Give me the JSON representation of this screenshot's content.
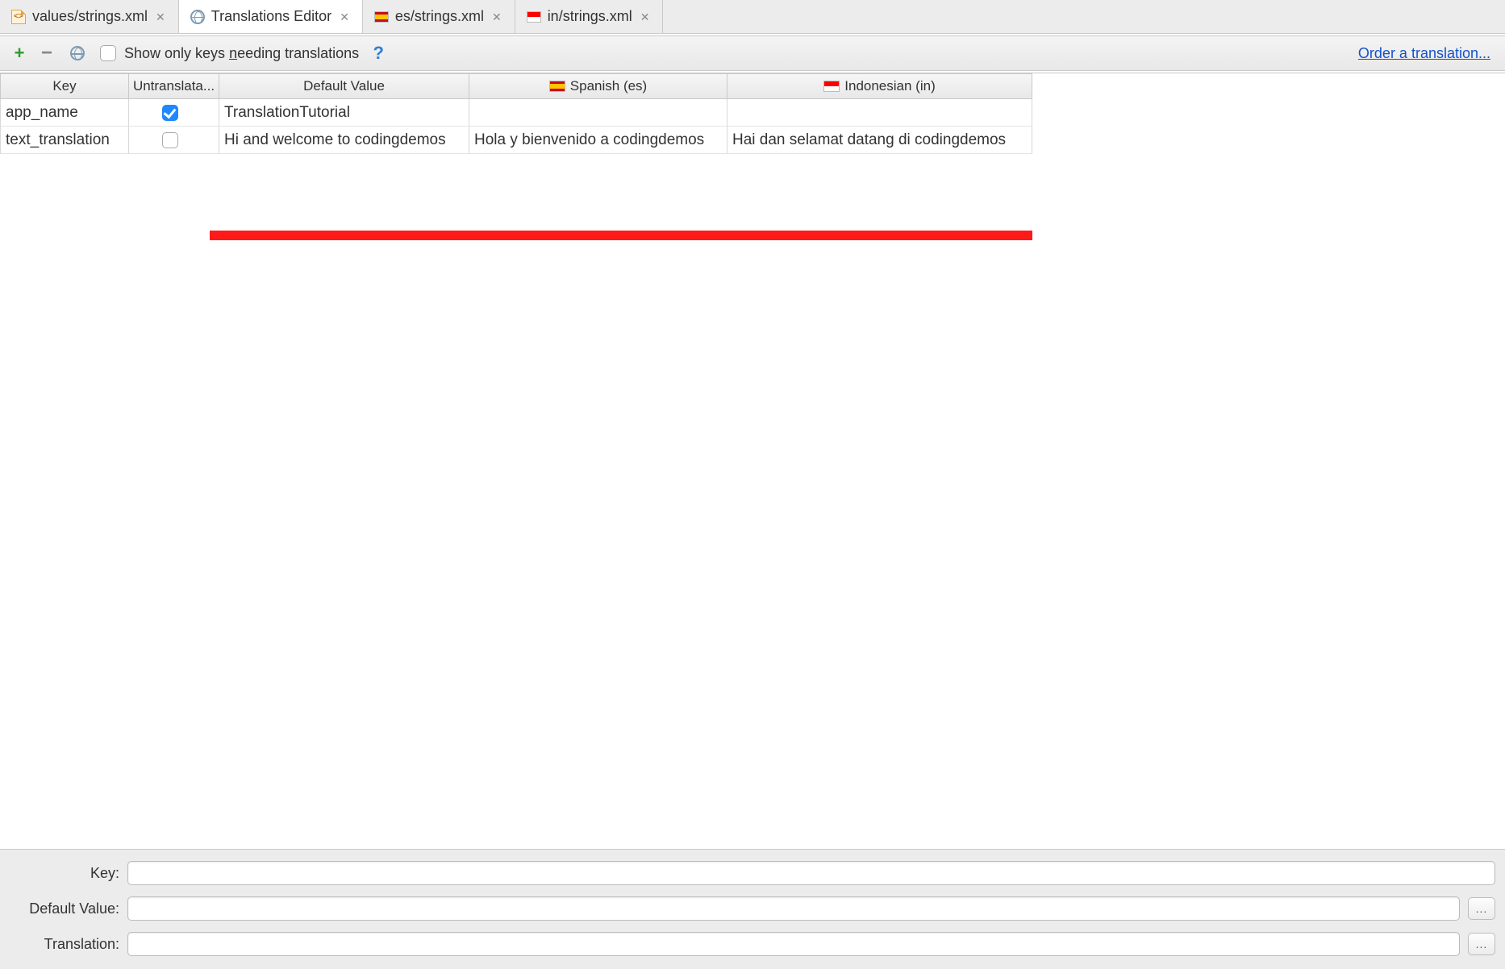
{
  "tabs": [
    {
      "label": "values/strings.xml",
      "icon": "xml",
      "active": false
    },
    {
      "label": "Translations Editor",
      "icon": "globe",
      "active": true
    },
    {
      "label": "es/strings.xml",
      "icon": "flag-es",
      "active": false
    },
    {
      "label": "in/strings.xml",
      "icon": "flag-in",
      "active": false
    }
  ],
  "toolbar": {
    "show_only_label_pre": "Show only keys ",
    "show_only_label_u": "n",
    "show_only_label_post": "eeding translations",
    "order_link": "Order a translation..."
  },
  "columns": {
    "key": "Key",
    "untranslatable": "Untranslata...",
    "default": "Default Value",
    "es": "Spanish (es)",
    "in": "Indonesian (in)"
  },
  "rows": [
    {
      "key": "app_name",
      "untranslatable": true,
      "default": "TranslationTutorial",
      "es": "",
      "in": ""
    },
    {
      "key": "text_translation",
      "untranslatable": false,
      "default": "Hi and welcome to codingdemos",
      "es": "Hola y bienvenido a codingdemos",
      "in": "Hai dan selamat datang di codingdemos"
    }
  ],
  "form": {
    "key_label": "Key:",
    "default_label": "Default Value:",
    "translation_label": "Translation:",
    "key_value": "",
    "default_value": "",
    "translation_value": "",
    "ellipsis": "..."
  }
}
